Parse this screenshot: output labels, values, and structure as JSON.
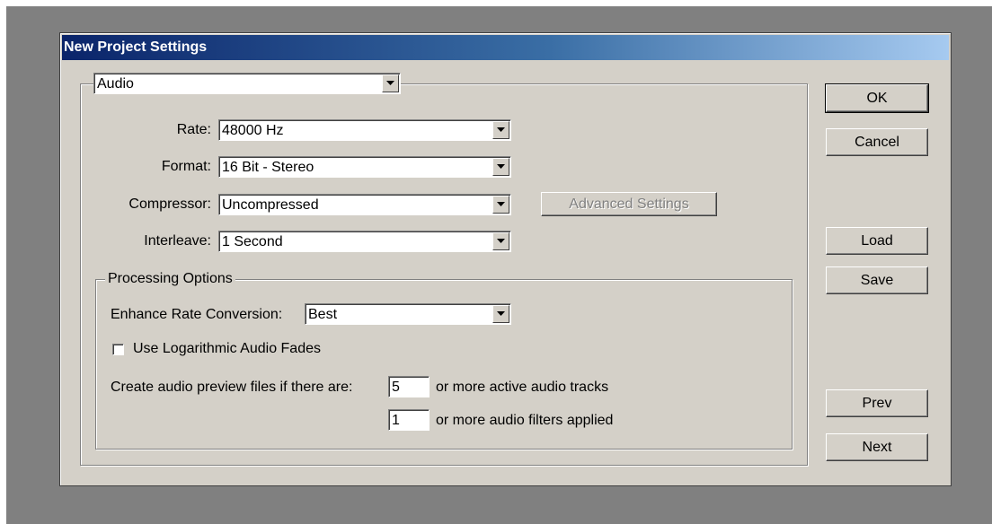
{
  "dialog": {
    "title": "New Project Settings"
  },
  "section_select": {
    "value": "Audio"
  },
  "fields": {
    "rate": {
      "label": "Rate:",
      "value": "48000 Hz"
    },
    "format": {
      "label": "Format:",
      "value": "16 Bit - Stereo"
    },
    "compressor": {
      "label": "Compressor:",
      "value": "Uncompressed"
    },
    "interleave": {
      "label": "Interleave:",
      "value": "1 Second"
    }
  },
  "advanced_settings_label": "Advanced Settings",
  "processing": {
    "group_label": "Processing Options",
    "enhance_label": "Enhance Rate Conversion:",
    "enhance_value": "Best",
    "log_fades_label": "Use Logarithmic Audio Fades",
    "log_fades_checked": false,
    "preview_label": "Create audio preview files if there are:",
    "tracks_value": "5",
    "tracks_suffix": "or more active audio tracks",
    "filters_value": "1",
    "filters_suffix": "or more audio filters applied"
  },
  "buttons": {
    "ok": "OK",
    "cancel": "Cancel",
    "load": "Load",
    "save": "Save",
    "prev": "Prev",
    "next": "Next"
  }
}
